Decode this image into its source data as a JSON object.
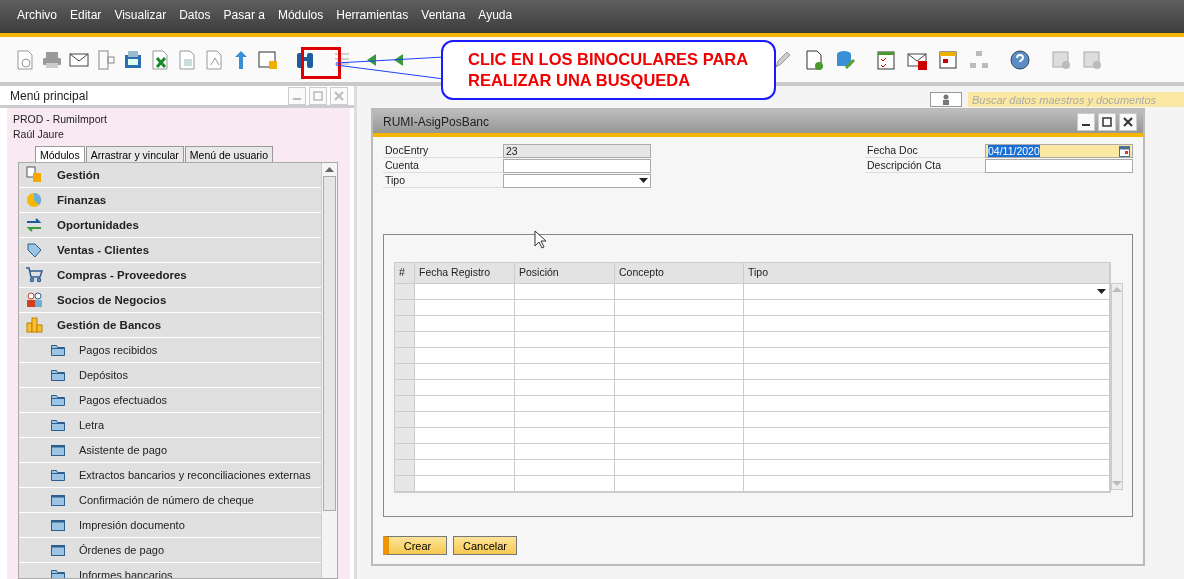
{
  "menu_bar": [
    "Archivo",
    "Editar",
    "Visualizar",
    "Datos",
    "Pasar a",
    "Módulos",
    "Herramientas",
    "Ventana",
    "Ayuda"
  ],
  "callout": {
    "text": "CLIC EN LOS BINOCULARES PARA REALIZAR UNA BUSQUEDA"
  },
  "main_menu": {
    "title": "Menú principal",
    "company": "PROD - RumiImport",
    "user": "Raúl Jaure",
    "tabs": [
      {
        "label": "Módulos",
        "selected": true
      },
      {
        "label": "Arrastrar y vincular",
        "selected": false
      },
      {
        "label": "Menú de usuario",
        "selected": false
      }
    ],
    "items": [
      {
        "label": "Gestión"
      },
      {
        "label": "Finanzas"
      },
      {
        "label": "Oportunidades"
      },
      {
        "label": "Ventas - Clientes"
      },
      {
        "label": "Compras - Proveedores"
      },
      {
        "label": "Socios de Negocios"
      },
      {
        "label": "Gestión de Bancos",
        "children": [
          {
            "label": "Pagos recibidos",
            "kind": "folder"
          },
          {
            "label": "Depósitos",
            "kind": "folder"
          },
          {
            "label": "Pagos efectuados",
            "kind": "folder"
          },
          {
            "label": "Letra",
            "kind": "folder"
          },
          {
            "label": "Asistente de pago",
            "kind": "form"
          },
          {
            "label": "Extractos bancarios y reconciliaciones externas",
            "kind": "folder"
          },
          {
            "label": "Confirmación de número de cheque",
            "kind": "form"
          },
          {
            "label": "Impresión documento",
            "kind": "form"
          },
          {
            "label": "Órdenes de pago",
            "kind": "form"
          },
          {
            "label": "Informes bancarios",
            "kind": "folder"
          }
        ]
      }
    ]
  },
  "search": {
    "placeholder": "Buscar datos maestros y documentos"
  },
  "form": {
    "title": "RUMI-AsigPosBanc",
    "left_fields": [
      {
        "label": "DocEntry",
        "value": "23",
        "kind": "readonly"
      },
      {
        "label": "Cuenta",
        "kind": "text"
      },
      {
        "label": "Tipo",
        "kind": "dropdown"
      }
    ],
    "right_fields": [
      {
        "label": "Fecha Doc",
        "value": "04/11/2020",
        "kind": "date",
        "focused": true
      },
      {
        "label": "Descripción Cta",
        "kind": "text",
        "focused": false
      }
    ],
    "matrix": {
      "columns": [
        "#",
        "Fecha Registro",
        "Posición",
        "Concepto",
        "Tipo"
      ]
    },
    "buttons": [
      "Crear",
      "Cancelar"
    ]
  }
}
